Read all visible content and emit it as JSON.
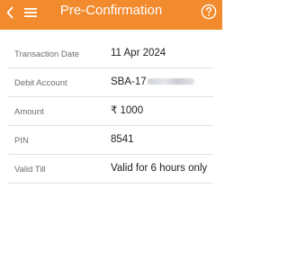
{
  "header": {
    "title": "Pre-Confirmation",
    "back_icon": "back-chevron-icon",
    "menu_icon": "hamburger-menu-icon",
    "help_icon": "help-circle-icon",
    "background_color": "#f28a2e"
  },
  "details": {
    "rows": [
      {
        "label": "Transaction Date",
        "value": "11 Apr 2024"
      },
      {
        "label": "Debit Account",
        "value": "SBA-17"
      },
      {
        "label": "Amount",
        "value": "₹ 1000"
      },
      {
        "label": "PIN",
        "value": "8541"
      },
      {
        "label": "Valid Till",
        "value": "Valid for 6 hours only"
      }
    ]
  }
}
